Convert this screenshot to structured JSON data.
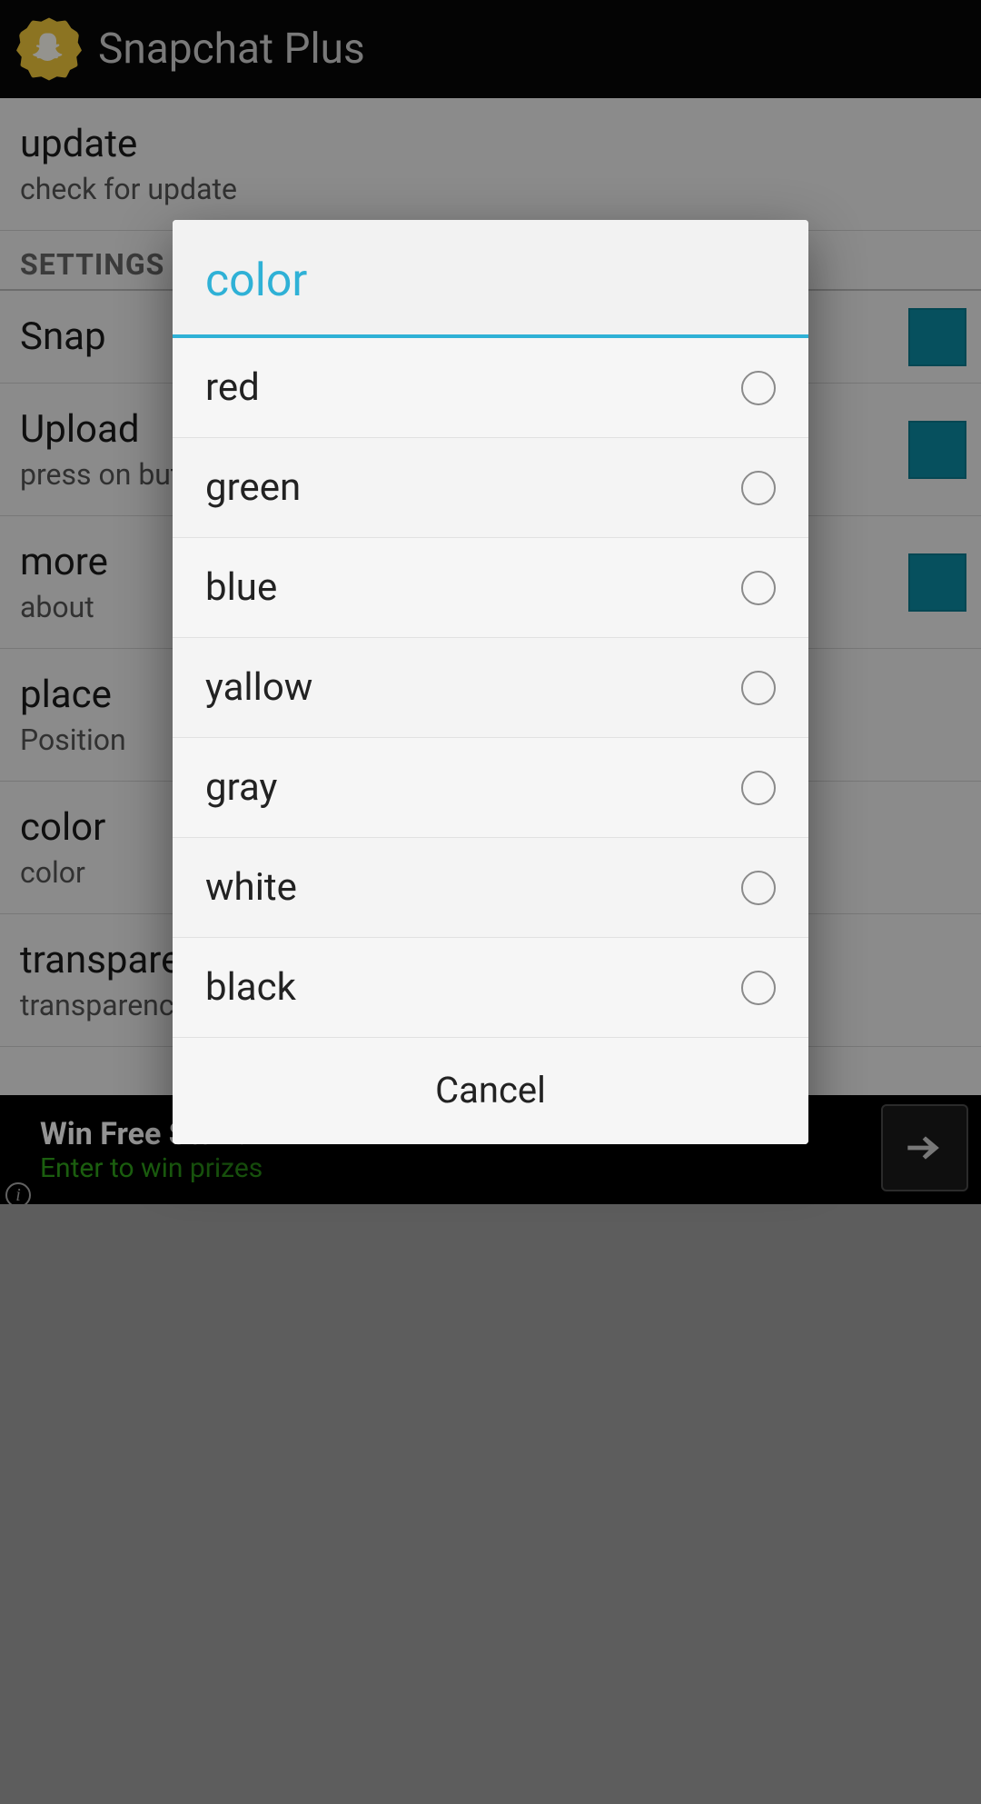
{
  "app": {
    "title": "Snapchat Plus"
  },
  "prefs": {
    "update": {
      "title": "update",
      "summary": "check for update"
    },
    "section": {
      "label": "SETTINGS"
    },
    "snap": {
      "title": "Snap"
    },
    "upload": {
      "title": "Upload",
      "summary": "press on button share in gallery\nto share with snapchat"
    },
    "more": {
      "title": "more",
      "summary": "about"
    },
    "place": {
      "title": "place",
      "summary": "Position"
    },
    "color": {
      "title": "color",
      "summary": "color"
    },
    "transparency": {
      "title": "transparency",
      "summary": "transparency"
    }
  },
  "ad": {
    "line1": "Win Free Stuff!",
    "line2": "Enter to win prizes"
  },
  "dialog": {
    "title": "color",
    "options": [
      "red",
      "green",
      "blue",
      "yallow",
      "gray",
      "white",
      "black"
    ],
    "cancel": "Cancel"
  }
}
